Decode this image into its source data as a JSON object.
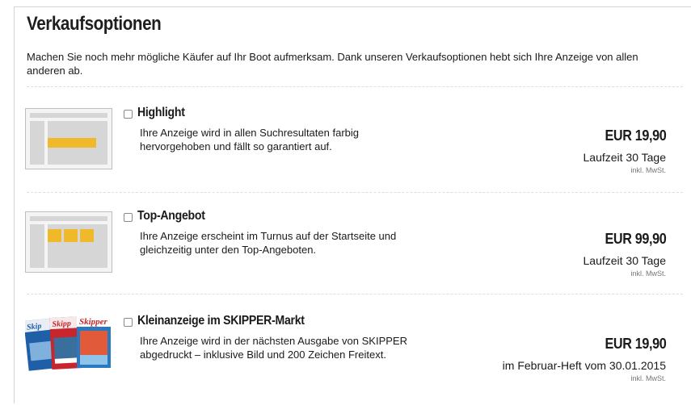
{
  "section": {
    "title": "Verkaufsoptionen",
    "intro": "Machen Sie noch mehr mögliche Käufer auf Ihr Boot aufmerksam. Dank unseren Verkaufsoptionen hebt sich Ihre Anzeige von allen anderen ab."
  },
  "options": [
    {
      "title": "Highlight",
      "description": "Ihre Anzeige wird in allen Suchresultaten farbig hervorgehoben und fällt so garantiert auf.",
      "price": "EUR 19,90",
      "runtime": "Laufzeit 30 Tage",
      "vat": "inkl. MwSt."
    },
    {
      "title": "Top-Angebot",
      "description": "Ihre Anzeige erscheint im Turnus auf der Startseite und gleichzeitig unter den Top-Angeboten.",
      "price": "EUR 99,90",
      "runtime": "Laufzeit 30 Tage",
      "vat": "inkl. MwSt."
    },
    {
      "title": "Kleinanzeige im SKIPPER-Markt",
      "description": "Ihre Anzeige wird in der nächsten Ausgabe von SKIPPER abgedruckt – inklusive Bild und 200 Zeichen Freitext.",
      "price": "EUR 19,90",
      "runtime": "im Februar-Heft vom 30.01.2015",
      "vat": "inkl. MwSt.",
      "magazine_label": "Skipper"
    }
  ],
  "colors": {
    "highlight": "#f0b92a",
    "placeholder": "#d6d6d6",
    "magazine_red": "#c8262c",
    "magazine_blue": "#1f5fa8"
  },
  "icons": [
    "highlight-preview-icon",
    "top-offer-preview-icon",
    "skipper-magazine-image"
  ]
}
